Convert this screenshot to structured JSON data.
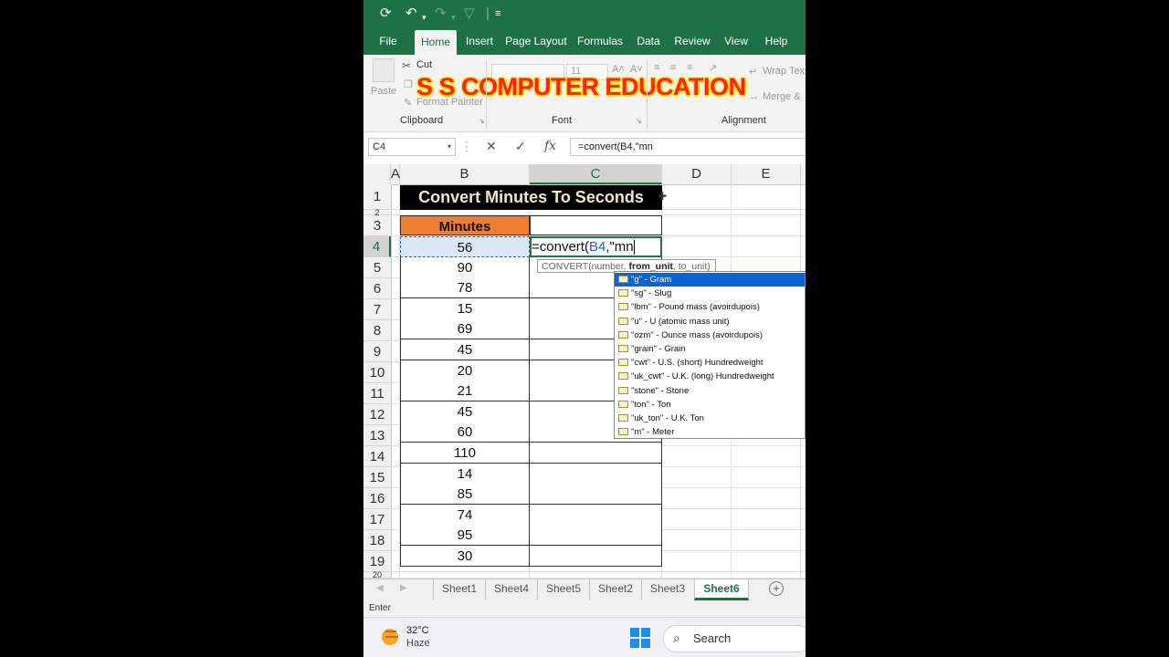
{
  "quick_access": {
    "separator": "|",
    "more": "≡"
  },
  "ribbon_tabs": [
    {
      "label": "File"
    },
    {
      "label": "Home"
    },
    {
      "label": "Insert"
    },
    {
      "label": "Page Layout"
    },
    {
      "label": "Formulas"
    },
    {
      "label": "Data"
    },
    {
      "label": "Review"
    },
    {
      "label": "View"
    },
    {
      "label": "Help"
    }
  ],
  "ribbon": {
    "cut": "Cut",
    "paste": "Paste",
    "format_painter": "Format Painter",
    "font_size": "11",
    "wrap_text": "Wrap Tex",
    "merge": "Merge &",
    "groups": {
      "clipboard": "Clipboard",
      "font": "Font",
      "alignment": "Alignment"
    },
    "watermark": "S S COMPUTER EDUCATION"
  },
  "formula_bar": {
    "name_box": "C4",
    "formula": "=convert(B4,\"mn"
  },
  "columns": [
    "A",
    "B",
    "C",
    "D",
    "E"
  ],
  "rows": [
    "1",
    "2",
    "3",
    "4",
    "5",
    "6",
    "7",
    "8",
    "9",
    "10",
    "11",
    "12",
    "13",
    "14",
    "15",
    "16",
    "17",
    "18",
    "19",
    "20"
  ],
  "sheet": {
    "title": "Convert Minutes To Seconds",
    "header_minutes": "Minutes",
    "minutes": [
      "56",
      "90",
      "78",
      "15",
      "69",
      "45",
      "20",
      "21",
      "45",
      "60",
      "110",
      "14",
      "85",
      "74",
      "95",
      "30"
    ],
    "edit_prefix": "=convert(",
    "edit_ref": "B4",
    "edit_suffix": ",\"mn"
  },
  "tooltip": {
    "prefix": "CONVERT(number, ",
    "bold": "from_unit",
    "suffix": ", to_unit)"
  },
  "autocomplete": [
    "\"g\" - Gram",
    "\"sg\" - Slug",
    "\"lbm\" - Pound mass (avoirdupois)",
    "\"u\" - U (atomic mass unit)",
    "\"ozm\" - Ounce mass (avoirdupois)",
    "\"grain\" - Grain",
    "\"cwt\" - U.S. (short) Hundredweight",
    "\"uk_cwt\" - U.K. (long) Hundredweight",
    "\"stone\" - Stone",
    "\"ton\" - Ton",
    "\"uk_ton\" - U.K. Ton",
    "\"m\" - Meter"
  ],
  "sheet_tabs": [
    "Sheet1",
    "Sheet4",
    "Sheet5",
    "Sheet2",
    "Sheet3",
    "Sheet6"
  ],
  "active_sheet": "Sheet6",
  "status": "Enter",
  "taskbar": {
    "temperature": "32°C",
    "weather": "Haze",
    "search": "Search"
  },
  "colors": {
    "excel_green": "#1e7145",
    "header_orange": "#ed7d31",
    "title_bg": "#000000",
    "selection_blue": "#0a64d6"
  }
}
